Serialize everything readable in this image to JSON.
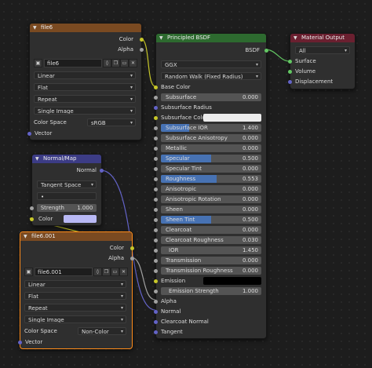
{
  "file6": {
    "title": "file6",
    "out_color": "Color",
    "out_alpha": "Alpha",
    "image_name": "file6",
    "interpolation": "Linear",
    "projection": "Flat",
    "extension": "Repeat",
    "source": "Single Image",
    "color_space_label": "Color Space",
    "color_space": "sRGB",
    "in_vector": "Vector"
  },
  "normalmap": {
    "title": "Normal/Map",
    "out_normal": "Normal",
    "space": "Tangent Space",
    "uvmap": "•",
    "strength_label": "Strength",
    "strength_value": "1.000",
    "color_label": "Color",
    "color_swatch": "#b9b9f5"
  },
  "file6001": {
    "title": "file6.001",
    "out_color": "Color",
    "out_alpha": "Alpha",
    "image_name": "file6.001",
    "interpolation": "Linear",
    "projection": "Flat",
    "extension": "Repeat",
    "source": "Single Image",
    "color_space_label": "Color Space",
    "color_space": "Non-Color",
    "in_vector": "Vector"
  },
  "bsdf": {
    "title": "Principled BSDF",
    "out_bsdf": "BSDF",
    "distribution": "GGX",
    "subsurface_method": "Random Walk (Fixed Radius)",
    "base_color": "Base Color",
    "subsurface_label": "Subsurface",
    "subsurface_value": "0.000",
    "subsurface_radius": "Subsurface Radius",
    "subsurface_color": "Subsurface Color",
    "subsurface_ior_label": "Subsurface IOR",
    "subsurface_ior_value": "1.400",
    "subsurface_aniso_label": "Subsurface Anisotropy",
    "subsurface_aniso_value": "0.000",
    "metallic_label": "Metallic",
    "metallic_value": "0.000",
    "specular_label": "Specular",
    "specular_value": "0.500",
    "specular_tint_label": "Specular Tint",
    "specular_tint_value": "0.000",
    "roughness_label": "Roughness",
    "roughness_value": "0.553",
    "anisotropic_label": "Anisotropic",
    "anisotropic_value": "0.000",
    "aniso_rot_label": "Anisotropic Rotation",
    "aniso_rot_value": "0.000",
    "sheen_label": "Sheen",
    "sheen_value": "0.000",
    "sheen_tint_label": "Sheen Tint",
    "sheen_tint_value": "0.500",
    "clearcoat_label": "Clearcoat",
    "clearcoat_value": "0.000",
    "clearcoat_rough_label": "Clearcoat Roughness",
    "clearcoat_rough_value": "0.030",
    "ior_label": "IOR",
    "ior_value": "1.450",
    "transmission_label": "Transmission",
    "transmission_value": "0.000",
    "transmission_rough_label": "Transmission Roughness",
    "transmission_rough_value": "0.000",
    "emission_label": "Emission",
    "emission_strength_label": "Emission Strength",
    "emission_strength_value": "1.000",
    "alpha": "Alpha",
    "normal": "Normal",
    "clearcoat_normal": "Clearcoat Normal",
    "tangent": "Tangent",
    "subsurface_color_swatch": "#ececec",
    "emission_swatch": "#000000",
    "fill_subsurface_ior": 0.28,
    "fill_specular": 0.5,
    "fill_roughness": 0.553,
    "fill_sheen_tint": 0.5
  },
  "output": {
    "title": "Material Output",
    "target": "All",
    "surface": "Surface",
    "volume": "Volume",
    "displacement": "Displacement"
  }
}
